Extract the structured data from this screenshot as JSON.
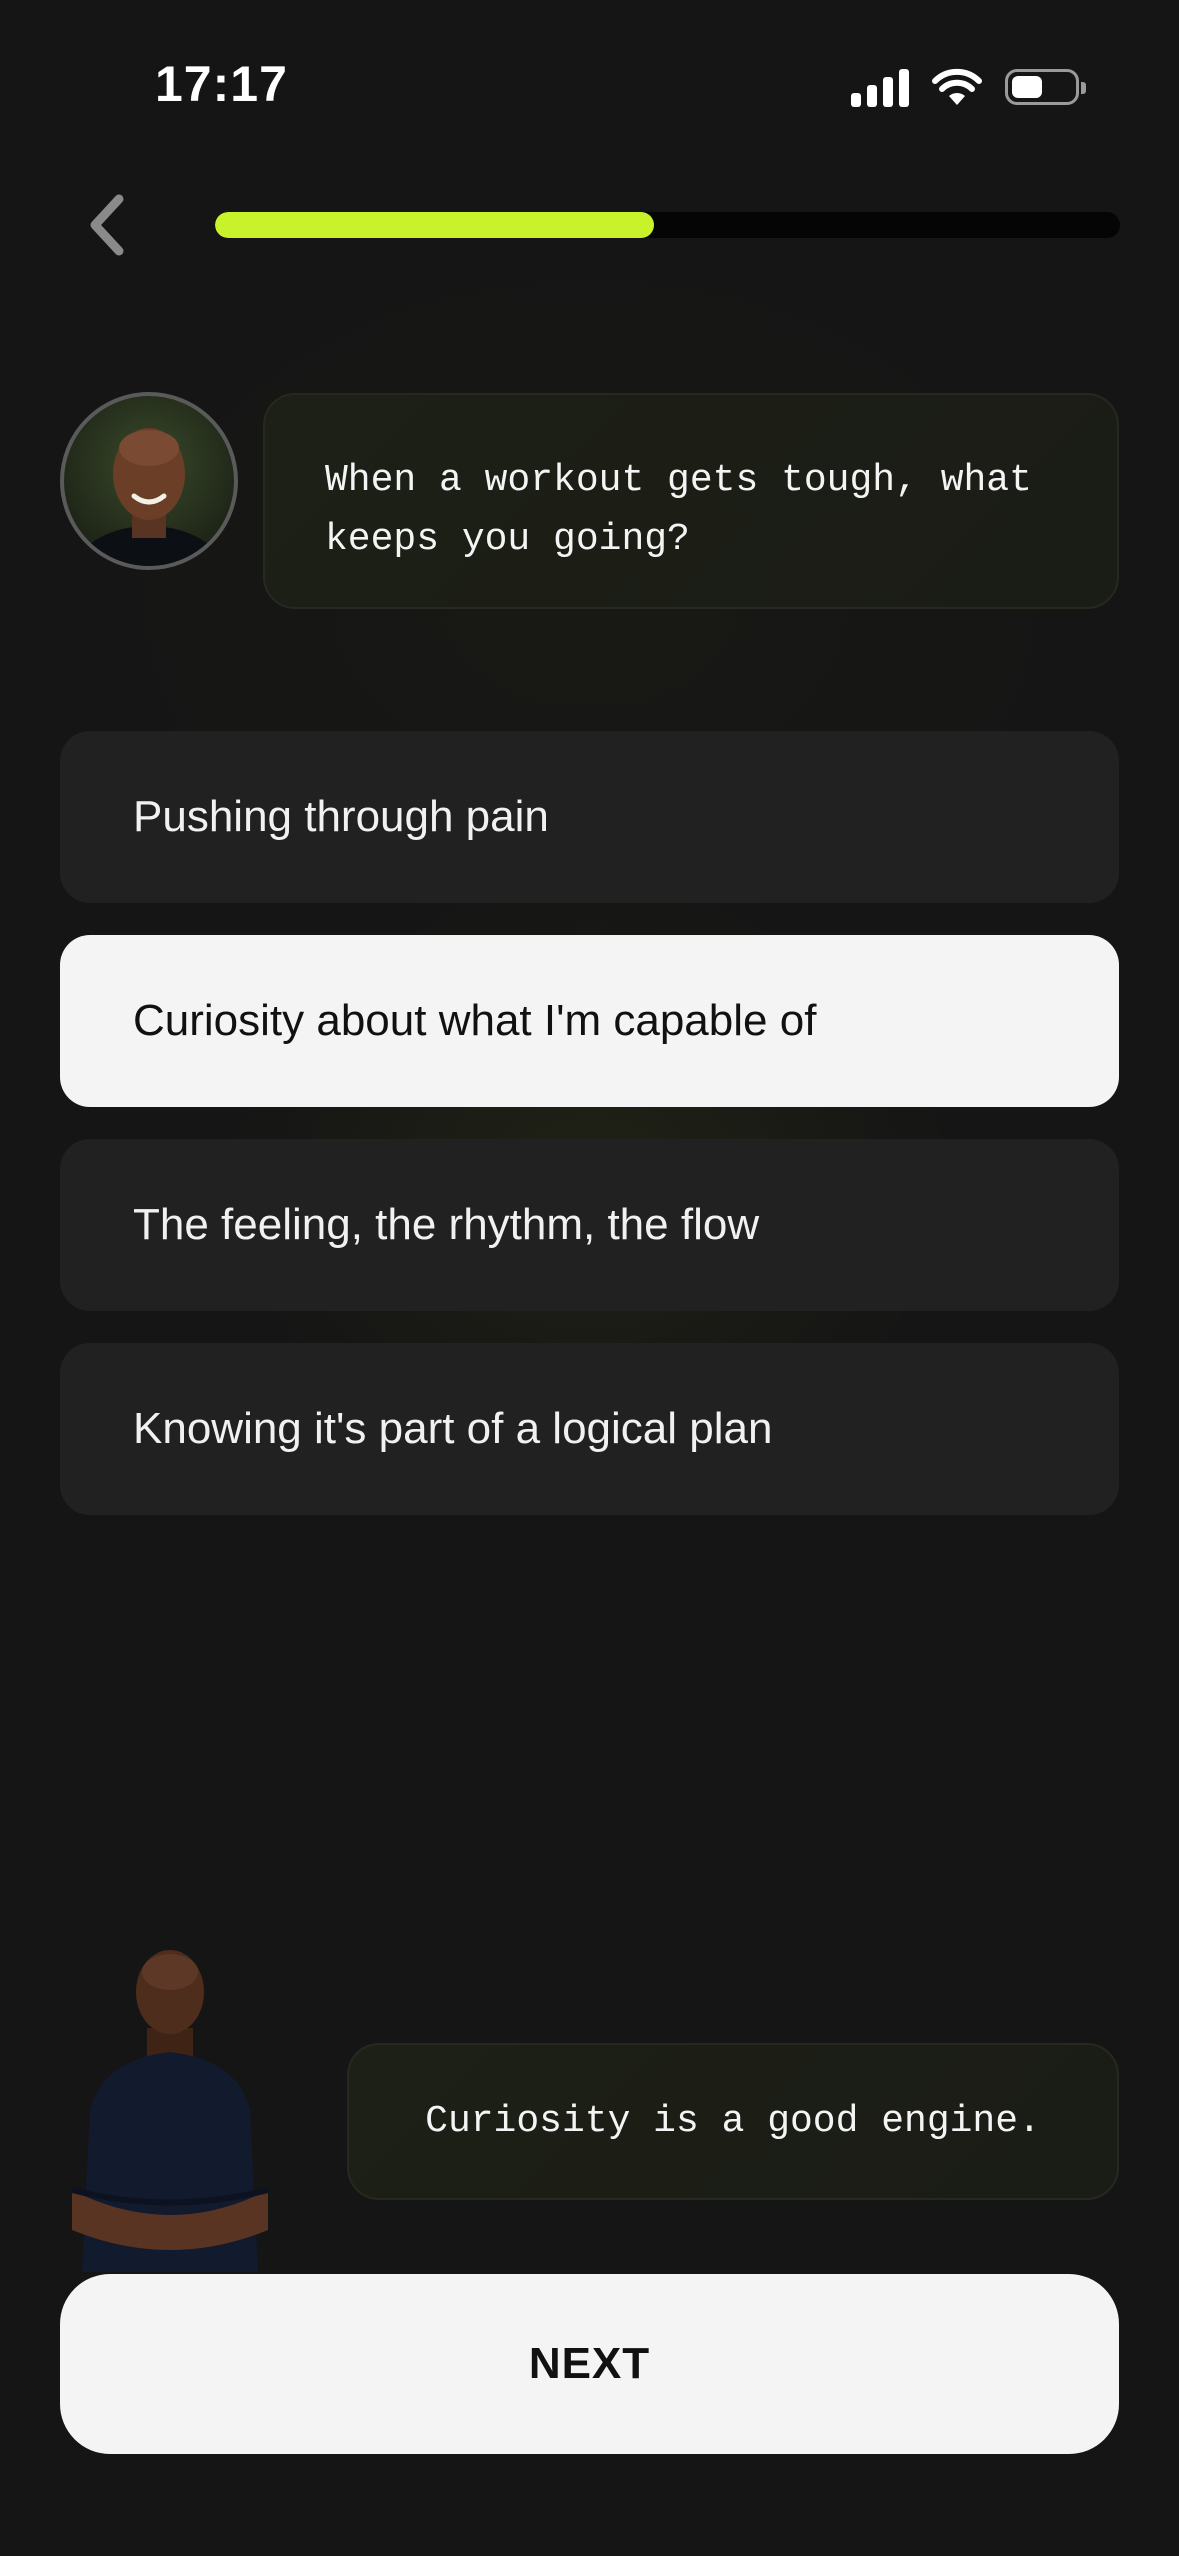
{
  "status_bar": {
    "time": "17:17"
  },
  "progress": {
    "fraction": 0.485,
    "color": "#c8f22a"
  },
  "icons": {
    "back": "chevron-left-icon",
    "signal": "cellular-signal-icon",
    "wifi": "wifi-icon",
    "battery": "battery-icon"
  },
  "coach": {
    "question": "When a workout gets tough, what keeps you going?",
    "reply": "Curiosity is a good engine."
  },
  "options": [
    {
      "label": "Pushing through pain",
      "selected": false
    },
    {
      "label": "Curiosity about what I'm capable of",
      "selected": true
    },
    {
      "label": "The feeling, the rhythm, the flow",
      "selected": false
    },
    {
      "label": "Knowing it's part of a logical plan",
      "selected": false
    }
  ],
  "next_button": {
    "label": "NEXT"
  },
  "colors": {
    "background": "#151515",
    "accent": "#c8f22a",
    "selected_option": "#f4f4f4",
    "option": "#212121"
  }
}
